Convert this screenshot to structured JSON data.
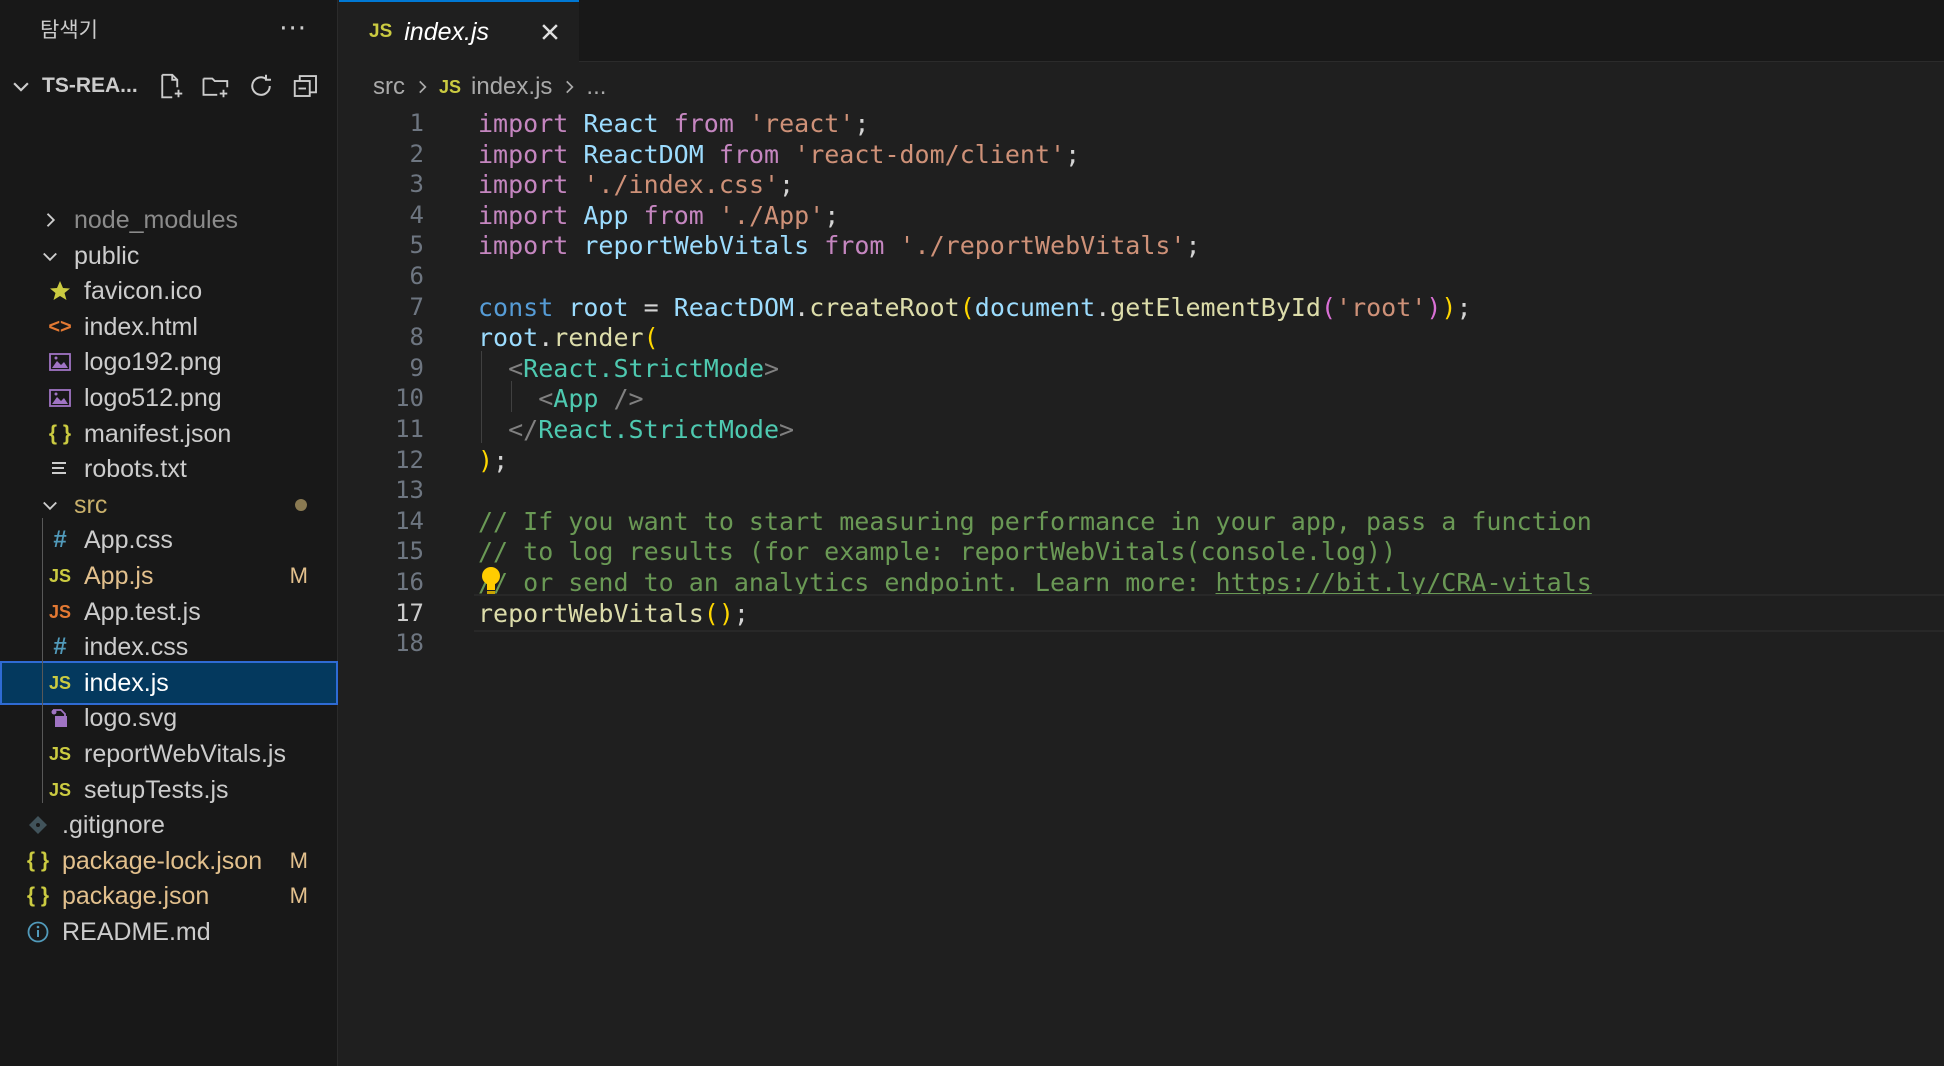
{
  "sidebar": {
    "title": "탐색기",
    "more": "···",
    "project": {
      "name": "TS-REA..."
    },
    "items": [
      {
        "label": "node_modules",
        "type": "folder",
        "expanded": false,
        "icon": "chevron-right-icon",
        "color": "#8b8b8b",
        "deco": ""
      },
      {
        "label": "public",
        "type": "folder",
        "expanded": true,
        "icon": "chevron-down-icon",
        "color": "#cccccc",
        "deco": ""
      },
      {
        "label": "favicon.ico",
        "type": "file",
        "icon": "star-icon",
        "color": "#cccccc",
        "deco": ""
      },
      {
        "label": "index.html",
        "type": "file",
        "icon": "html-icon",
        "color": "#cccccc",
        "deco": ""
      },
      {
        "label": "logo192.png",
        "type": "file",
        "icon": "image-icon",
        "color": "#cccccc",
        "deco": ""
      },
      {
        "label": "logo512.png",
        "type": "file",
        "icon": "image-icon",
        "color": "#cccccc",
        "deco": ""
      },
      {
        "label": "manifest.json",
        "type": "file",
        "icon": "json-icon",
        "color": "#cccccc",
        "deco": ""
      },
      {
        "label": "robots.txt",
        "type": "file",
        "icon": "text-lines-icon",
        "color": "#cccccc",
        "deco": ""
      },
      {
        "label": "src",
        "type": "folder",
        "expanded": true,
        "icon": "chevron-down-icon",
        "color": "#c9b06b",
        "deco": "dot"
      },
      {
        "label": "App.css",
        "type": "file",
        "icon": "css-hash-icon",
        "color": "#cccccc",
        "deco": ""
      },
      {
        "label": "App.js",
        "type": "file",
        "icon": "js-icon",
        "color": "#e2c08d",
        "deco": "M"
      },
      {
        "label": "App.test.js",
        "type": "file",
        "icon": "js-test-icon",
        "color": "#cccccc",
        "deco": ""
      },
      {
        "label": "index.css",
        "type": "file",
        "icon": "css-hash-icon",
        "color": "#cccccc",
        "deco": ""
      },
      {
        "label": "index.js",
        "type": "file",
        "icon": "js-icon",
        "color": "#ffffff",
        "deco": "",
        "selected": true
      },
      {
        "label": "logo.svg",
        "type": "file",
        "icon": "svg-icon",
        "color": "#cccccc",
        "deco": ""
      },
      {
        "label": "reportWebVitals.js",
        "type": "file",
        "icon": "js-icon",
        "color": "#cccccc",
        "deco": ""
      },
      {
        "label": "setupTests.js",
        "type": "file",
        "icon": "js-icon",
        "color": "#cccccc",
        "deco": ""
      },
      {
        "label": ".gitignore",
        "type": "file",
        "icon": "git-icon",
        "color": "#cccccc",
        "deco": ""
      },
      {
        "label": "package-lock.json",
        "type": "file",
        "icon": "json-icon",
        "color": "#e2c08d",
        "deco": "M"
      },
      {
        "label": "package.json",
        "type": "file",
        "icon": "json-icon",
        "color": "#e2c08d",
        "deco": "M"
      },
      {
        "label": "README.md",
        "type": "file",
        "icon": "info-icon",
        "color": "#cccccc",
        "deco": ""
      }
    ]
  },
  "editor": {
    "tab": {
      "icon_text": "JS",
      "label": "index.js"
    },
    "breadcrumb": {
      "folder": "src",
      "icon_text": "JS",
      "file": "index.js",
      "more": "..."
    },
    "active_line": 17,
    "lines": [
      {
        "n": "1",
        "tokens": [
          [
            "ctl",
            "import"
          ],
          [
            "",
            "&nbsp;"
          ],
          [
            "var",
            "React"
          ],
          [
            "",
            "&nbsp;"
          ],
          [
            "ctl",
            "from"
          ],
          [
            "",
            "&nbsp;"
          ],
          [
            "str",
            "'react'"
          ],
          [
            "",
            ";"
          ]
        ]
      },
      {
        "n": "2",
        "tokens": [
          [
            "ctl",
            "import"
          ],
          [
            "",
            "&nbsp;"
          ],
          [
            "var",
            "ReactDOM"
          ],
          [
            "",
            "&nbsp;"
          ],
          [
            "ctl",
            "from"
          ],
          [
            "",
            "&nbsp;"
          ],
          [
            "str",
            "'react-dom/client'"
          ],
          [
            "",
            ";"
          ]
        ]
      },
      {
        "n": "3",
        "tokens": [
          [
            "ctl",
            "import"
          ],
          [
            "",
            "&nbsp;"
          ],
          [
            "str",
            "'./index.css'"
          ],
          [
            "",
            ";"
          ]
        ]
      },
      {
        "n": "4",
        "tokens": [
          [
            "ctl",
            "import"
          ],
          [
            "",
            "&nbsp;"
          ],
          [
            "var",
            "App"
          ],
          [
            "",
            "&nbsp;"
          ],
          [
            "ctl",
            "from"
          ],
          [
            "",
            "&nbsp;"
          ],
          [
            "str",
            "'./App'"
          ],
          [
            "",
            ";"
          ]
        ]
      },
      {
        "n": "5",
        "tokens": [
          [
            "ctl",
            "import"
          ],
          [
            "",
            "&nbsp;"
          ],
          [
            "var",
            "reportWebVitals"
          ],
          [
            "",
            "&nbsp;"
          ],
          [
            "ctl",
            "from"
          ],
          [
            "",
            "&nbsp;"
          ],
          [
            "str",
            "'./reportWebVitals'"
          ],
          [
            "",
            ";"
          ]
        ]
      },
      {
        "n": "6",
        "tokens": []
      },
      {
        "n": "7",
        "tokens": [
          [
            "kw",
            "const"
          ],
          [
            "",
            "&nbsp;"
          ],
          [
            "var",
            "root"
          ],
          [
            "",
            "&nbsp;=&nbsp;"
          ],
          [
            "var",
            "ReactDOM"
          ],
          [
            "",
            "."
          ],
          [
            "fn",
            "createRoot"
          ],
          [
            "b1",
            "("
          ],
          [
            "var",
            "document"
          ],
          [
            "",
            "."
          ],
          [
            "fn",
            "getElementById"
          ],
          [
            "b2",
            "("
          ],
          [
            "str",
            "'root'"
          ],
          [
            "b2",
            ")"
          ],
          [
            "b1",
            ")"
          ],
          [
            "",
            ";"
          ]
        ]
      },
      {
        "n": "8",
        "tokens": [
          [
            "var",
            "root"
          ],
          [
            "",
            "."
          ],
          [
            "fn",
            "render"
          ],
          [
            "b1",
            "("
          ]
        ]
      },
      {
        "n": "9",
        "tokens": [
          [
            "",
            "&nbsp;&nbsp;"
          ],
          [
            "tag",
            "&lt;"
          ],
          [
            "jsx",
            "React.StrictMode"
          ],
          [
            "tag",
            "&gt;"
          ]
        ]
      },
      {
        "n": "10",
        "tokens": [
          [
            "",
            "&nbsp;&nbsp;&nbsp;&nbsp;"
          ],
          [
            "tag",
            "&lt;"
          ],
          [
            "jsx",
            "App"
          ],
          [
            "",
            "&nbsp;"
          ],
          [
            "tag",
            "/&gt;"
          ]
        ]
      },
      {
        "n": "11",
        "tokens": [
          [
            "",
            "&nbsp;&nbsp;"
          ],
          [
            "tag",
            "&lt;/"
          ],
          [
            "jsx",
            "React.StrictMode"
          ],
          [
            "tag",
            "&gt;"
          ]
        ]
      },
      {
        "n": "12",
        "tokens": [
          [
            "b1",
            ")"
          ],
          [
            "",
            ";"
          ]
        ]
      },
      {
        "n": "13",
        "tokens": []
      },
      {
        "n": "14",
        "tokens": [
          [
            "cmt",
            "// If you want to start measuring performance in your app, pass a function"
          ]
        ]
      },
      {
        "n": "15",
        "tokens": [
          [
            "cmt",
            "// to log results (for example: reportWebVitals(console.log))"
          ]
        ]
      },
      {
        "n": "16",
        "tokens": [
          [
            "cmt",
            "// or send to an analytics endpoint. Learn more: "
          ],
          [
            "lnk",
            "https://bit.ly/CRA-vitals"
          ]
        ]
      },
      {
        "n": "17",
        "tokens": [
          [
            "fn",
            "reportWebVitals"
          ],
          [
            "b1",
            "()"
          ],
          [
            "",
            ";"
          ]
        ]
      },
      {
        "n": "18",
        "tokens": []
      }
    ]
  }
}
